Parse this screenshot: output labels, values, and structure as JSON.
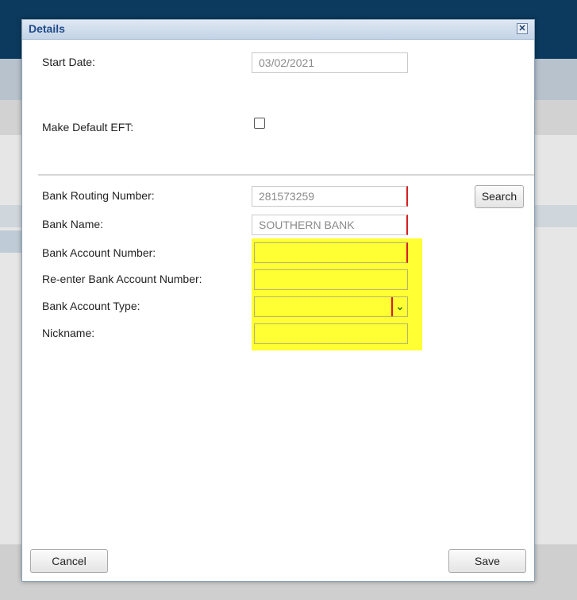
{
  "dialog": {
    "title": "Details",
    "close_glyph": "✕"
  },
  "form": {
    "start_date": {
      "label": "Start Date:",
      "value": "03/02/2021"
    },
    "make_default_eft": {
      "label": "Make Default EFT:",
      "checked": false
    },
    "bank_routing_number": {
      "label": "Bank Routing Number:",
      "value": "281573259"
    },
    "search_button": "Search",
    "bank_name": {
      "label": "Bank Name:",
      "value": "SOUTHERN BANK"
    },
    "bank_account_number": {
      "label": "Bank Account Number:",
      "value": ""
    },
    "reenter_bank_account_number": {
      "label": "Re-enter Bank Account Number:",
      "value": ""
    },
    "bank_account_type": {
      "label": "Bank Account Type:",
      "value": ""
    },
    "nickname": {
      "label": "Nickname:",
      "value": ""
    }
  },
  "footer": {
    "cancel_label": "Cancel",
    "save_label": "Save"
  },
  "colors": {
    "header_bar": "#0c3a5e",
    "dialog_title": "#1f4a8a",
    "highlight": "#ffff33",
    "required_marker": "#d42020"
  }
}
